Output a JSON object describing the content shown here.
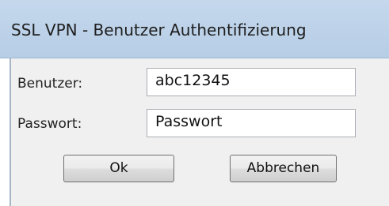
{
  "window": {
    "title": "SSL VPN - Benutzer Authentifizierung"
  },
  "form": {
    "user_label": "Benutzer:",
    "user_value": "abc12345",
    "password_label": "Passwort:",
    "password_value": "Passwort"
  },
  "buttons": {
    "ok_label": "Ok",
    "cancel_label": "Abbrechen"
  },
  "colors": {
    "titlebar": "#c5d8ec",
    "dialog_background": "#f0f0f0"
  }
}
